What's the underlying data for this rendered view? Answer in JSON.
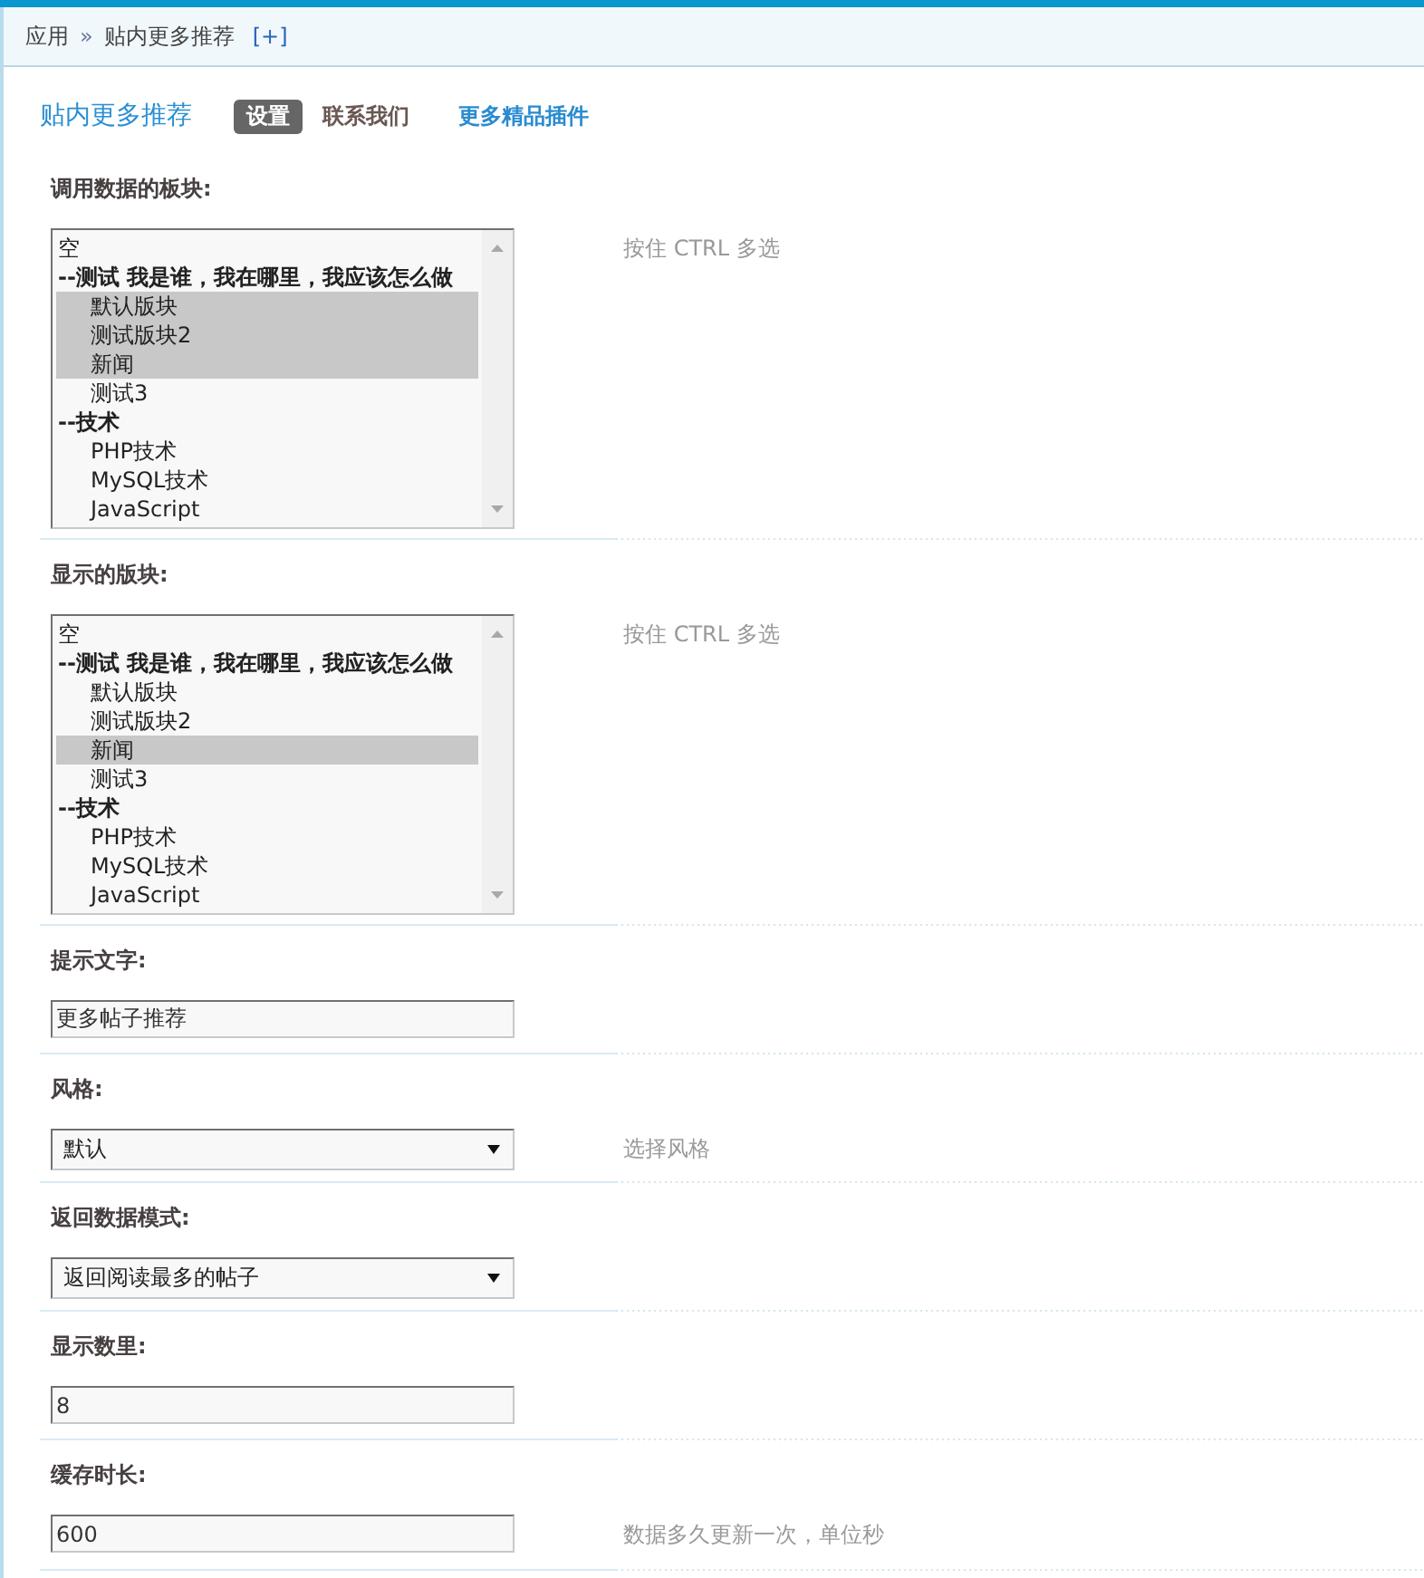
{
  "breadcrumb": {
    "items": [
      "应用",
      "贴内更多推荐"
    ],
    "separator": "»",
    "add_link": "[+]"
  },
  "header": {
    "title": "贴内更多推荐",
    "tabs": [
      {
        "label": "设置",
        "kind": "tab",
        "selected": true
      },
      {
        "label": "联系我们",
        "kind": "tab",
        "selected": false
      },
      {
        "label": "更多精品插件",
        "kind": "link",
        "selected": false
      }
    ]
  },
  "settings": [
    {
      "kind": "listbox",
      "label": "调用数据的板块:",
      "hint": "按住 CTRL 多选",
      "options": [
        {
          "label": "空",
          "selected": false
        },
        {
          "label": "--测试 我是谁，我在哪里，我应该怎么做",
          "selected": false,
          "children": [
            {
              "label": "默认版块",
              "selected": true
            },
            {
              "label": "测试版块2",
              "selected": true
            },
            {
              "label": "新闻",
              "selected": true
            },
            {
              "label": "测试3",
              "selected": false
            }
          ]
        },
        {
          "label": "--技术",
          "selected": false,
          "children": [
            {
              "label": "PHP技术",
              "selected": false
            },
            {
              "label": "MySQL技术",
              "selected": false
            },
            {
              "label": "JavaScript",
              "selected": false
            }
          ]
        }
      ]
    },
    {
      "kind": "listbox",
      "label": "显示的版块:",
      "hint": "按住 CTRL 多选",
      "options": [
        {
          "label": "空",
          "selected": false
        },
        {
          "label": "--测试 我是谁，我在哪里，我应该怎么做",
          "selected": false,
          "children": [
            {
              "label": "默认版块",
              "selected": false
            },
            {
              "label": "测试版块2",
              "selected": false
            },
            {
              "label": "新闻",
              "selected": true
            },
            {
              "label": "测试3",
              "selected": false
            }
          ]
        },
        {
          "label": "--技术",
          "selected": false,
          "children": [
            {
              "label": "PHP技术",
              "selected": false
            },
            {
              "label": "MySQL技术",
              "selected": false
            },
            {
              "label": "JavaScript",
              "selected": false
            }
          ]
        }
      ]
    },
    {
      "kind": "text",
      "label": "提示文字:",
      "value": "更多帖子推荐"
    },
    {
      "kind": "select",
      "label": "风格:",
      "value": "默认",
      "hint": "选择风格"
    },
    {
      "kind": "select",
      "label": "返回数据模式:",
      "value": "返回阅读最多的帖子"
    },
    {
      "kind": "text",
      "label": "显示数里:",
      "value": "8"
    },
    {
      "kind": "text",
      "label": "缓存时长:",
      "value": "600",
      "hint": "数据多久更新一次，单位秒"
    }
  ]
}
